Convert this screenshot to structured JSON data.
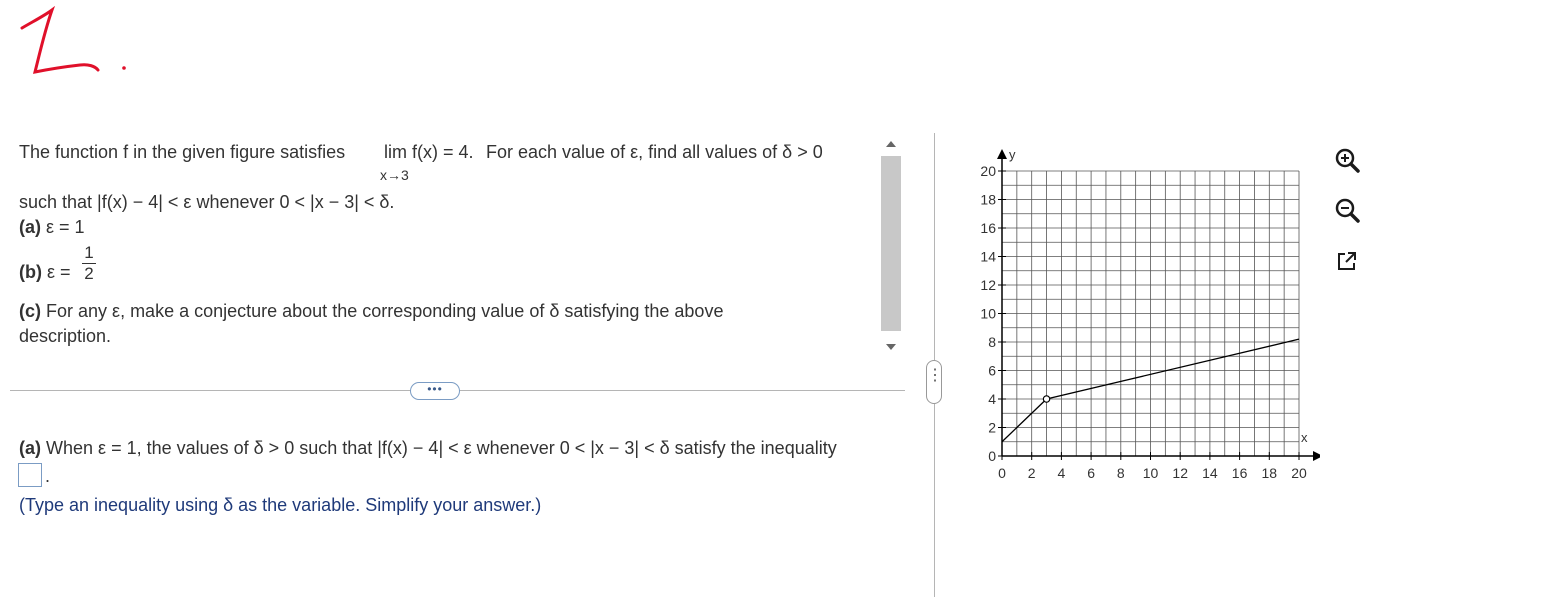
{
  "handwritten_mark": "1.",
  "question": {
    "line1_prefix": "The function f in the given figure satisfies",
    "limit_word": "lim f(x) = 4.",
    "limit_sub": "x→3",
    "line1_suffix": "For each value of ε, find all values of δ > 0",
    "line2": "such that |f(x) − 4| < ε whenever 0 < |x − 3| < δ.",
    "part_a_label": "(a)",
    "part_a_text": "ε = 1",
    "part_b_label": "(b)",
    "part_b_text": "ε =",
    "part_b_num": "1",
    "part_b_den": "2",
    "part_c_label": "(c)",
    "part_c_text": "For any ε, make a conjecture about the corresponding value of δ satisfying the above",
    "part_c_text2": "description."
  },
  "divider": {
    "more_label": "•••"
  },
  "side_handle": {
    "label": "⋮"
  },
  "answer": {
    "label": "(a)",
    "text": "When ε = 1, the values of δ > 0 such that |f(x) − 4| < ε whenever 0 < |x − 3| < δ satisfy the inequality",
    "period": ".",
    "input_value": "",
    "hint": "(Type an inequality using δ as the variable. Simplify your answer.)"
  },
  "tools": [
    "zoom-in-icon",
    "zoom-out-icon",
    "popout-icon"
  ],
  "chart_data": {
    "type": "line",
    "xlabel": "x",
    "ylabel": "y",
    "xlim": [
      0,
      20
    ],
    "ylim": [
      0,
      20
    ],
    "x_ticks": [
      0,
      2,
      4,
      6,
      8,
      10,
      12,
      14,
      16,
      18,
      20
    ],
    "y_ticks": [
      0,
      2,
      4,
      6,
      8,
      10,
      12,
      14,
      16,
      18,
      20
    ],
    "grid": true,
    "series": [
      {
        "points": [
          [
            0,
            1
          ],
          [
            3,
            4
          ],
          [
            20,
            8.2
          ]
        ]
      }
    ],
    "open_points": [
      [
        3,
        4
      ]
    ],
    "colors": {
      "line": "#000000",
      "grid": "#555555"
    }
  }
}
